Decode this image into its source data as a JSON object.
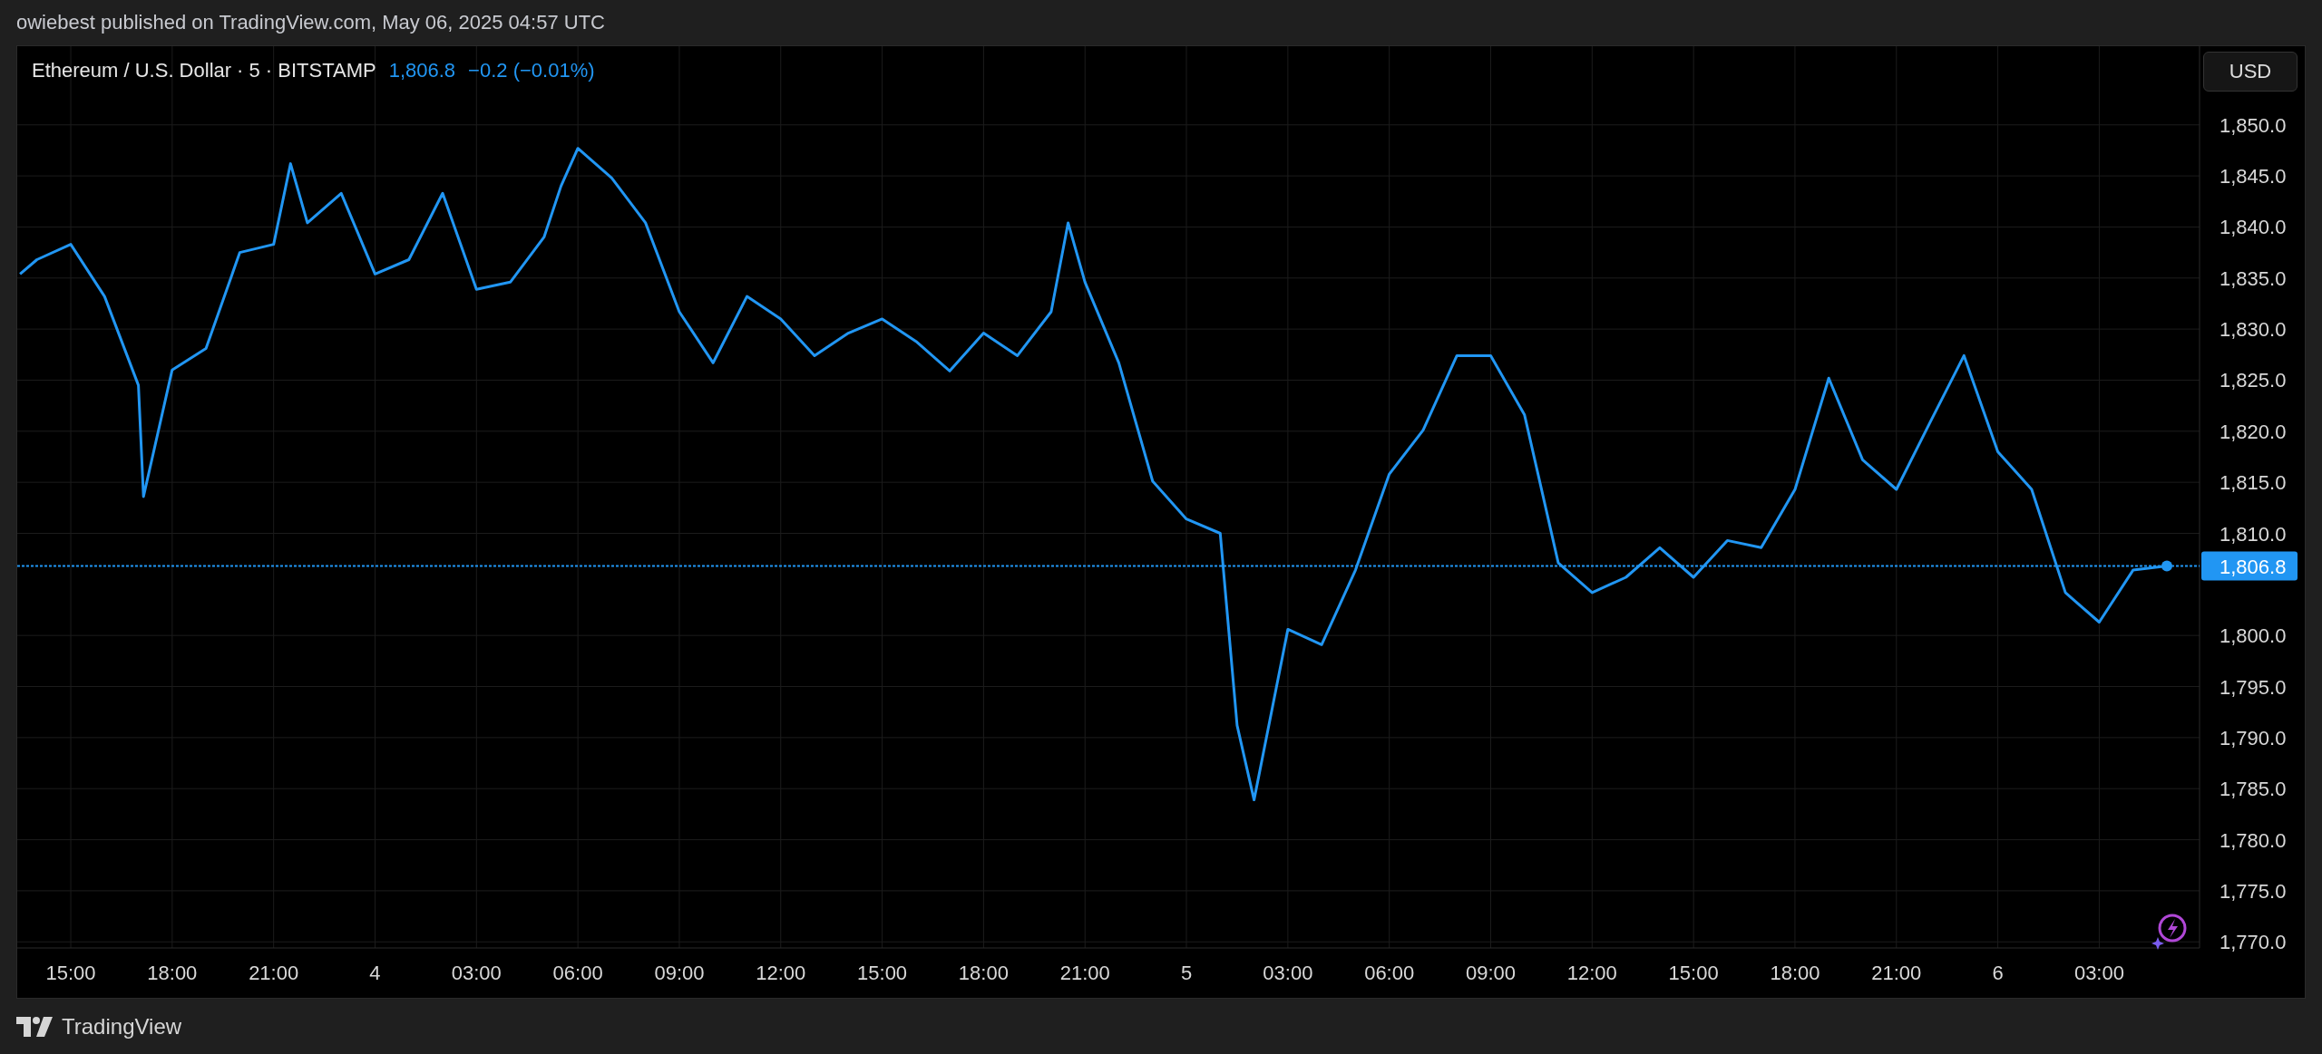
{
  "header": {
    "attribution": "owiebest published on TradingView.com, May 06, 2025 04:57 UTC"
  },
  "chart": {
    "legend": {
      "suffix": "· 5 · BITSTAMP",
      "price": "1,806.8",
      "change": "−0.2 (−0.01%)"
    },
    "currency_button": "USD",
    "chart_data": {
      "type": "line",
      "grid": true,
      "x": [
        "2025-05-03T13:30",
        "2025-05-03T14:00",
        "2025-05-03T15:00",
        "2025-05-03T16:00",
        "2025-05-03T17:00",
        "2025-05-03T17:09",
        "2025-05-03T18:00",
        "2025-05-03T19:00",
        "2025-05-03T20:00",
        "2025-05-03T21:00",
        "2025-05-03T21:30",
        "2025-05-03T22:00",
        "2025-05-03T23:00",
        "2025-05-04T00:00",
        "2025-05-04T01:00",
        "2025-05-04T02:00",
        "2025-05-04T03:00",
        "2025-05-04T04:00",
        "2025-05-04T05:00",
        "2025-05-04T05:30",
        "2025-05-04T06:00",
        "2025-05-04T07:00",
        "2025-05-04T08:00",
        "2025-05-04T09:00",
        "2025-05-04T10:00",
        "2025-05-04T11:00",
        "2025-05-04T12:00",
        "2025-05-04T13:00",
        "2025-05-04T14:00",
        "2025-05-04T15:00",
        "2025-05-04T16:00",
        "2025-05-04T17:00",
        "2025-05-04T18:00",
        "2025-05-04T19:00",
        "2025-05-04T20:00",
        "2025-05-04T20:30",
        "2025-05-04T21:00",
        "2025-05-04T22:00",
        "2025-05-04T23:00",
        "2025-05-05T00:00",
        "2025-05-05T01:00",
        "2025-05-05T01:30",
        "2025-05-05T02:00",
        "2025-05-05T03:00",
        "2025-05-05T04:00",
        "2025-05-05T05:00",
        "2025-05-05T06:00",
        "2025-05-05T07:00",
        "2025-05-05T08:00",
        "2025-05-05T09:00",
        "2025-05-05T10:00",
        "2025-05-05T11:00",
        "2025-05-05T12:00",
        "2025-05-05T13:00",
        "2025-05-05T14:00",
        "2025-05-05T15:00",
        "2025-05-05T16:00",
        "2025-05-05T17:00",
        "2025-05-05T18:00",
        "2025-05-05T19:00",
        "2025-05-05T20:00",
        "2025-05-05T21:00",
        "2025-05-05T22:00",
        "2025-05-05T23:00",
        "2025-05-06T00:00",
        "2025-05-06T01:00",
        "2025-05-06T02:00",
        "2025-05-06T03:00",
        "2025-05-06T04:00",
        "2025-05-06T05:00"
      ],
      "series": [
        {
          "name": "Ethereum / U.S. Dollar",
          "color": "#2196f3",
          "values": [
            1835.4,
            1836.8,
            1838.3,
            1833.2,
            1824.5,
            1813.6,
            1826,
            1828.1,
            1837.5,
            1838.3,
            1846.2,
            1840.4,
            1843.3,
            1835.4,
            1836.8,
            1843.3,
            1833.9,
            1834.6,
            1839,
            1844,
            1847.7,
            1844.8,
            1840.4,
            1831.7,
            1826.7,
            1833.2,
            1831,
            1827.4,
            1829.6,
            1831,
            1828.8,
            1825.9,
            1829.6,
            1827.4,
            1831.7,
            1840.4,
            1834.6,
            1826.7,
            1815.1,
            1811.4,
            1810,
            1791.2,
            1783.9,
            1800.6,
            1799.1,
            1806.4,
            1815.8,
            1820.1,
            1827.4,
            1827.4,
            1821.6,
            1807.1,
            1804.2,
            1805.7,
            1808.6,
            1805.7,
            1809.3,
            1808.6,
            1814.3,
            1825.2,
            1817.2,
            1814.3,
            1820.9,
            1827.4,
            1818,
            1814.3,
            1804.2,
            1801.3,
            1806.4,
            1806.8
          ]
        }
      ],
      "ref_lines": [
        {
          "axis": "y",
          "value": 1806.8,
          "label": "1,806.8"
        }
      ],
      "xlim": [
        "2025-05-03T13:25",
        "2025-05-06T05:58"
      ],
      "ylim": [
        1769.4,
        1857.7
      ],
      "xticks": [
        {
          "value": "2025-05-03T15:00",
          "label": "15:00"
        },
        {
          "value": "2025-05-03T18:00",
          "label": "18:00"
        },
        {
          "value": "2025-05-03T21:00",
          "label": "21:00"
        },
        {
          "value": "2025-05-04T00:00",
          "label": "4"
        },
        {
          "value": "2025-05-04T03:00",
          "label": "03:00"
        },
        {
          "value": "2025-05-04T06:00",
          "label": "06:00"
        },
        {
          "value": "2025-05-04T09:00",
          "label": "09:00"
        },
        {
          "value": "2025-05-04T12:00",
          "label": "12:00"
        },
        {
          "value": "2025-05-04T15:00",
          "label": "15:00"
        },
        {
          "value": "2025-05-04T18:00",
          "label": "18:00"
        },
        {
          "value": "2025-05-04T21:00",
          "label": "21:00"
        },
        {
          "value": "2025-05-05T00:00",
          "label": "5"
        },
        {
          "value": "2025-05-05T03:00",
          "label": "03:00"
        },
        {
          "value": "2025-05-05T06:00",
          "label": "06:00"
        },
        {
          "value": "2025-05-05T09:00",
          "label": "09:00"
        },
        {
          "value": "2025-05-05T12:00",
          "label": "12:00"
        },
        {
          "value": "2025-05-05T15:00",
          "label": "15:00"
        },
        {
          "value": "2025-05-05T18:00",
          "label": "18:00"
        },
        {
          "value": "2025-05-05T21:00",
          "label": "21:00"
        },
        {
          "value": "2025-05-06T00:00",
          "label": "6"
        },
        {
          "value": "2025-05-06T03:00",
          "label": "03:00"
        }
      ],
      "yticks": [
        {
          "value": 1850,
          "label": "1,850.0"
        },
        {
          "value": 1845,
          "label": "1,845.0"
        },
        {
          "value": 1840,
          "label": "1,840.0"
        },
        {
          "value": 1835,
          "label": "1,835.0"
        },
        {
          "value": 1830,
          "label": "1,830.0"
        },
        {
          "value": 1825,
          "label": "1,825.0"
        },
        {
          "value": 1820,
          "label": "1,820.0"
        },
        {
          "value": 1815,
          "label": "1,815.0"
        },
        {
          "value": 1810,
          "label": "1,810.0"
        },
        {
          "value": 1800,
          "label": "1,800.0"
        },
        {
          "value": 1795,
          "label": "1,795.0"
        },
        {
          "value": 1790,
          "label": "1,790.0"
        },
        {
          "value": 1785,
          "label": "1,785.0"
        },
        {
          "value": 1780,
          "label": "1,780.0"
        },
        {
          "value": 1775,
          "label": "1,775.0"
        },
        {
          "value": 1770,
          "label": "1,770.0"
        }
      ]
    }
  },
  "footer": {
    "brand": "TradingView"
  }
}
